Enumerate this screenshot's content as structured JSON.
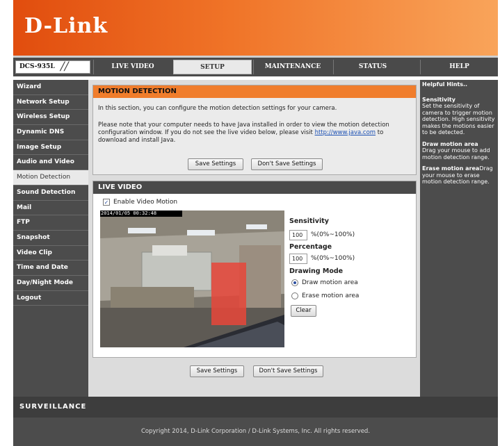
{
  "brand": {
    "logo_text": "D-Link",
    "model": "DCS-935L",
    "slash": "//",
    "footer_brand": "SURVEILLANCE"
  },
  "nav": {
    "tabs": [
      "LIVE VIDEO",
      "SETUP",
      "MAINTENANCE",
      "STATUS",
      "HELP"
    ],
    "active": "SETUP"
  },
  "sidebar": {
    "items": [
      "Wizard",
      "Network Setup",
      "Wireless Setup",
      "Dynamic DNS",
      "Image Setup",
      "Audio and Video",
      "Motion Detection",
      "Sound Detection",
      "Mail",
      "FTP",
      "Snapshot",
      "Video Clip",
      "Time and Date",
      "Day/Night Mode",
      "Logout"
    ],
    "active": "Motion Detection"
  },
  "motion": {
    "title": "MOTION DETECTION",
    "intro": "In this section, you can configure the motion detection settings for your camera.",
    "java_line1": "Please note that your computer needs to have Java installed in order to view the motion detection",
    "java_line2_prefix": "configuration window. If you do not see the live video below, please visit ",
    "java_link": "http://www.java.com",
    "java_line2_suffix": " to",
    "java_line3": "download and install Java.",
    "save_label": "Save Settings",
    "dont_save_label": "Don't Save Settings"
  },
  "live": {
    "title": "LIVE VIDEO",
    "enable_label": "Enable Video Motion",
    "enabled": true,
    "timestamp": "2014/01/05 00:32:48",
    "sensitivity_label": "Sensitivity",
    "sensitivity_value": "100",
    "sensitivity_range": "%(0%~100%)",
    "percentage_label": "Percentage",
    "percentage_value": "100",
    "percentage_range": "%(0%~100%)",
    "drawing_mode_label": "Drawing Mode",
    "draw_label": "Draw motion area",
    "erase_label": "Erase motion area",
    "clear_label": "Clear",
    "selected_mode": "draw"
  },
  "bottom": {
    "save_label": "Save Settings",
    "dont_save_label": "Don't Save Settings"
  },
  "hints": {
    "title": "Helpful Hints..",
    "items": [
      {
        "title": "Sensitivity",
        "text": "Set the sensitivity of camera to trigger motion detection. High sensitivity makes the motions easier to be detected."
      },
      {
        "title": "Draw motion area",
        "text": "Drag your mouse to add motion detection range."
      },
      {
        "title": "Erase motion area",
        "text": "Drag your mouse to erase motion detection range."
      }
    ]
  },
  "copyright": "Copyright 2014, D-Link Corporation / D-Link Systems, Inc. All rights reserved.",
  "colors": {
    "accent_orange": "#f07d2c",
    "dark_gray": "#4a4a4a",
    "motion_area": "#e8463a"
  }
}
